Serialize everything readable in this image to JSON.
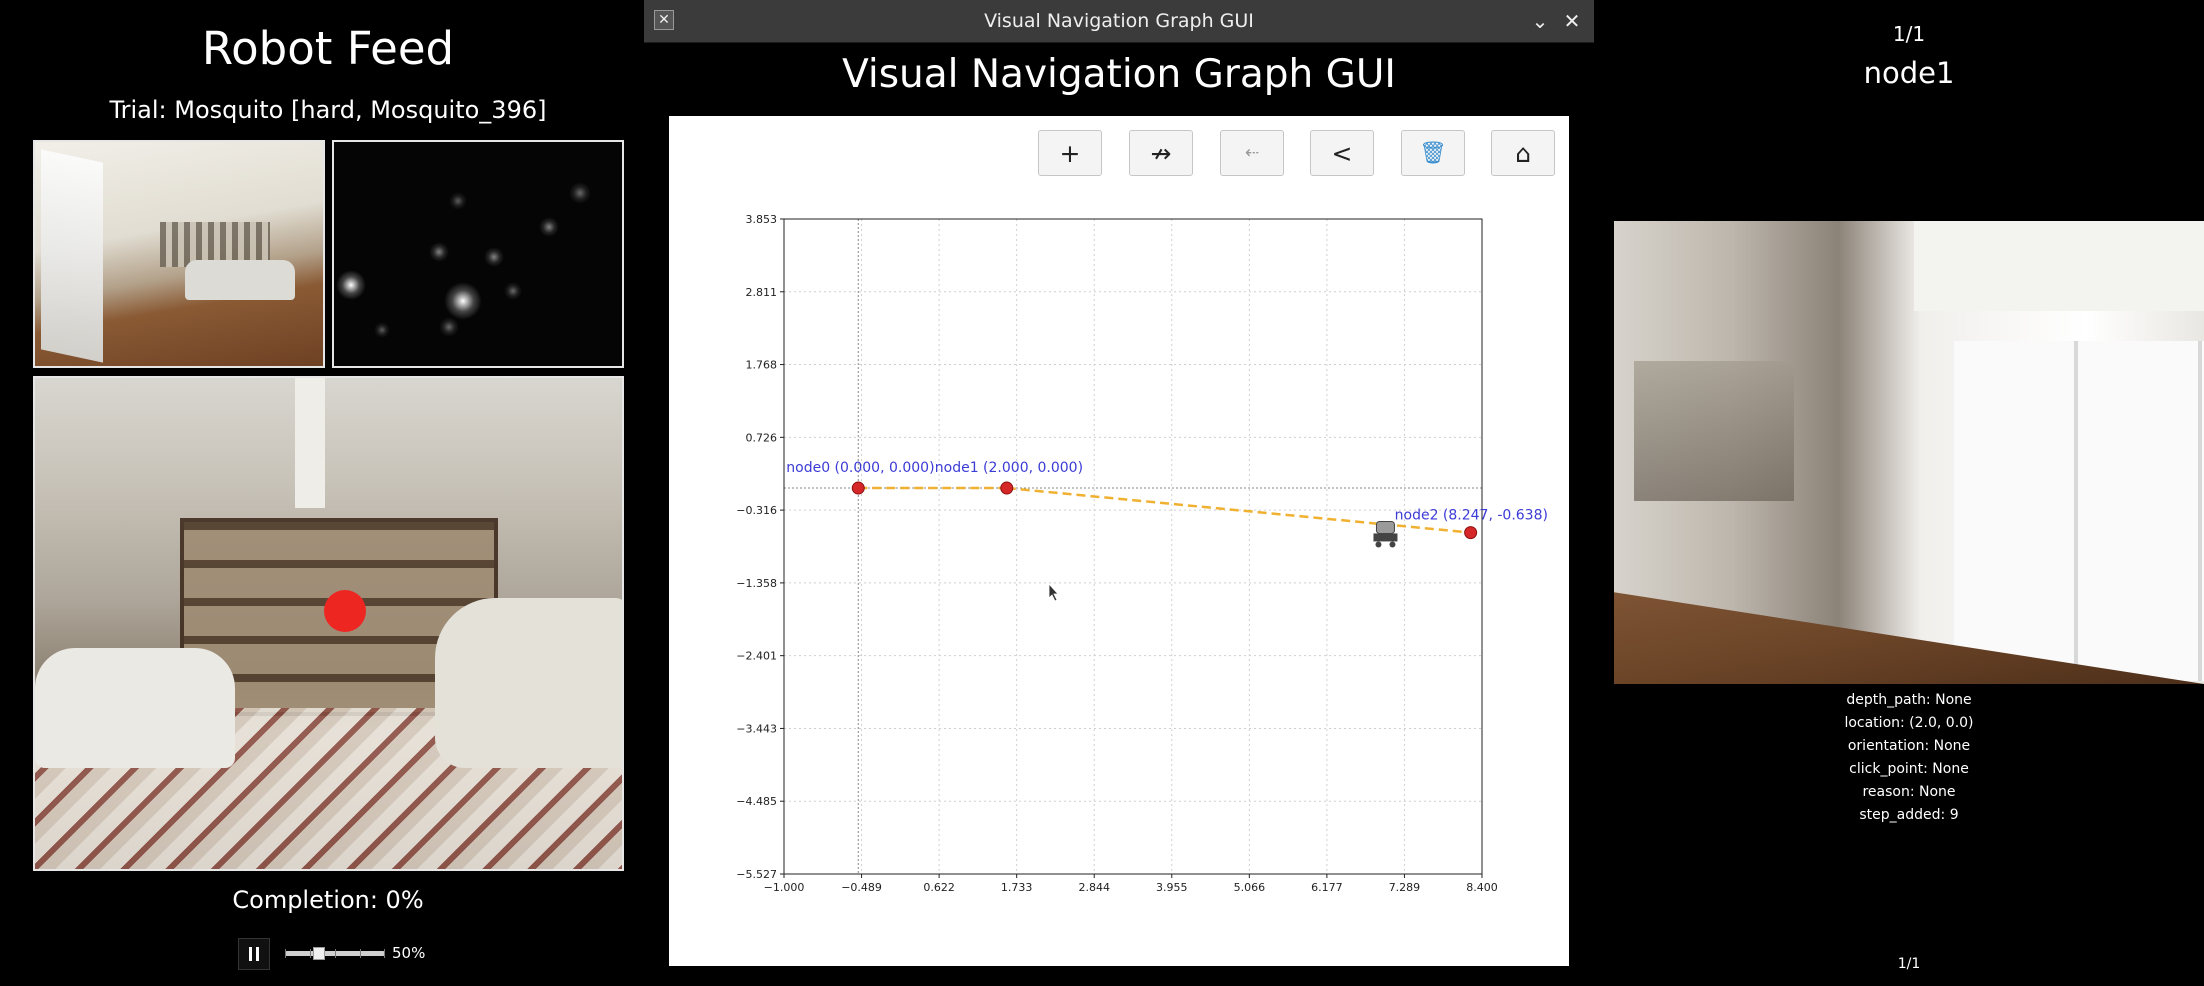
{
  "left_panel": {
    "title": "Robot Feed",
    "trial": "Trial: Mosquito [hard, Mosquito_396]",
    "completion": "Completion: 0%",
    "speed_label": "50%",
    "speed": 0.5
  },
  "window": {
    "titlebar": "Visual Navigation Graph GUI",
    "heading": "Visual Navigation Graph GUI",
    "toolbar": [
      {
        "name": "add-node-button",
        "icon": "+"
      },
      {
        "name": "connect-nodes-button",
        "icon": "↛"
      },
      {
        "name": "go-to-node-button",
        "icon": "⇠"
      },
      {
        "name": "back-button",
        "icon": "<"
      },
      {
        "name": "delete-button",
        "icon": "🗑"
      },
      {
        "name": "home-button",
        "icon": "⌂"
      }
    ]
  },
  "chart_data": {
    "type": "scatter",
    "xlim": [
      -1.0,
      8.4
    ],
    "ylim": [
      -5.527,
      3.853
    ],
    "xticks": [
      "−1.000",
      "−0.489",
      "0.622",
      "1.733",
      "2.844",
      "3.955",
      "5.066",
      "6.177",
      "7.289",
      "8.400"
    ],
    "yticks": [
      "3.853",
      "2.811",
      "1.768",
      "0.726",
      "−0.316",
      "−1.358",
      "−2.401",
      "−3.443",
      "−4.485",
      "−5.527"
    ],
    "grid": true,
    "nodes": [
      {
        "label": "node0 (0.000, 0.000)",
        "x": 0.0,
        "y": 0.0
      },
      {
        "label": "node1 (2.000, 0.000)",
        "x": 2.0,
        "y": 0.0
      },
      {
        "label": "node2 (8.247, -0.638)",
        "x": 8.247,
        "y": -0.638
      }
    ],
    "edges": [
      [
        0,
        1
      ],
      [
        1,
        2
      ]
    ],
    "robot": {
      "x": 7.1,
      "y": -0.65
    },
    "colors": {
      "node": "#d62728",
      "edge": "#f0b030",
      "label": "#3b3bd6",
      "robot": "#444444"
    }
  },
  "right_panel": {
    "page_top": "1/1",
    "node_name": "node1",
    "info": [
      "depth_path: None",
      "location: (2.0, 0.0)",
      "orientation: None",
      "click_point: None",
      "reason: None",
      "step_added: 9"
    ],
    "page_bottom": "1/1"
  }
}
